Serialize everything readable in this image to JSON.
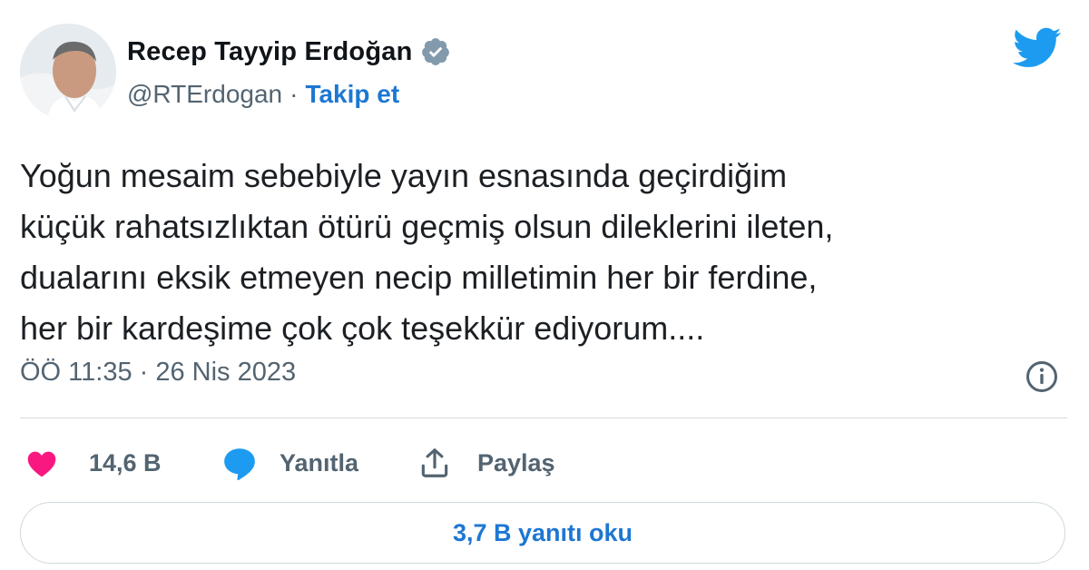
{
  "author": {
    "name": "Recep Tayyip Erdoğan",
    "handle": "@RTErdogan",
    "separator": "·",
    "follow_label": "Takip et"
  },
  "tweet": {
    "lines": [
      "Yoğun mesaim sebebiyle yayın esnasında geçirdiğim",
      "küçük rahatsızlıktan ötürü geçmiş olsun dileklerini ileten,",
      "dualarını eksik etmeyen necip milletimin her bir ferdine,",
      "her bir kardeşime çok çok teşekkür ediyorum...."
    ],
    "timestamp": "ÖÖ 11:35 · 26 Nis 2023"
  },
  "actions": {
    "likes": "14,6 B",
    "reply_label": "Yanıtla",
    "share_label": "Paylaş"
  },
  "read_replies_label": "3,7 B yanıtı oku",
  "colors": {
    "accent": "#1d9bf0",
    "link": "#1d77d2",
    "like": "#f91880",
    "secondary_text": "#536471"
  },
  "icons": [
    "verified-badge-icon",
    "twitter-bird-icon",
    "info-icon",
    "heart-icon",
    "reply-bubble-icon",
    "share-icon"
  ]
}
